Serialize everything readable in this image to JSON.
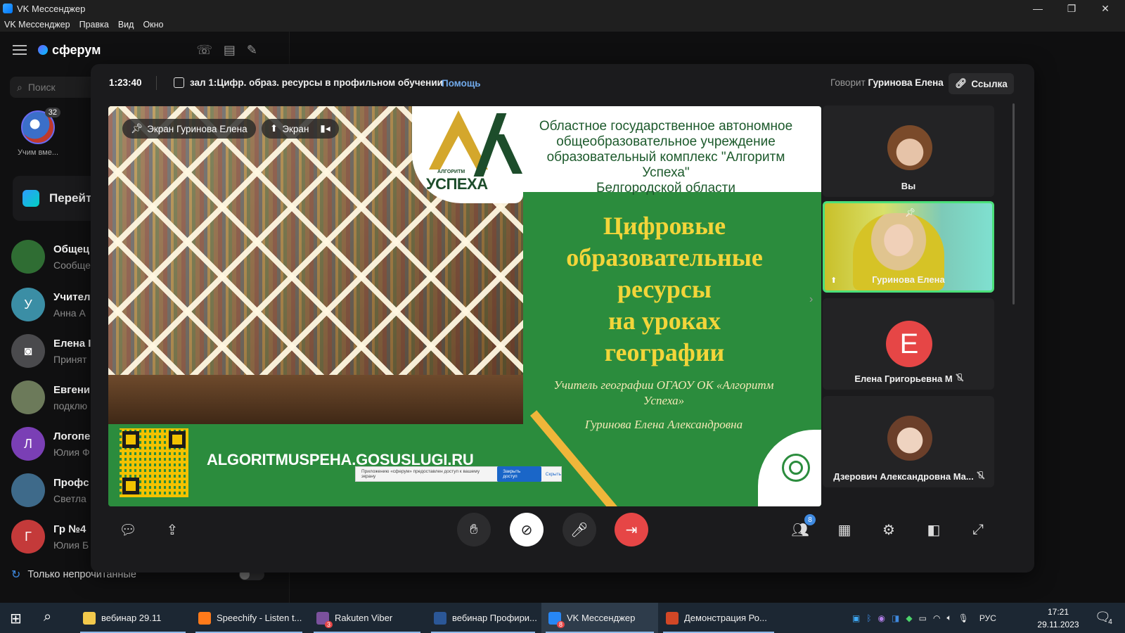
{
  "window": {
    "title": "VK Мессенджер",
    "menu": [
      "VK Мессенджер",
      "Правка",
      "Вид",
      "Окно"
    ]
  },
  "sidebar": {
    "brand": "сферум",
    "search_placeholder": "Поиск",
    "story": {
      "count": "32",
      "label": "Учим вме..."
    },
    "goto_label": "Перейт",
    "chats": [
      {
        "name": "Общец",
        "preview": "Сообще",
        "avatar": "logo",
        "color": "#2f6d33"
      },
      {
        "name": "Учител",
        "preview": "Анна А",
        "avatar": "У",
        "color": "#3b8ea5"
      },
      {
        "name": "Елена I",
        "preview": "Принят",
        "avatar": "camera",
        "color": "#4a4a4d"
      },
      {
        "name": "Евгени",
        "preview": "подклю",
        "avatar": "photo",
        "color": "#6c7a5a"
      },
      {
        "name": "Логопе",
        "preview": "Юлия Ф",
        "avatar": "Л",
        "color": "#7a3fb5"
      },
      {
        "name": "Профс",
        "preview": "Светла",
        "avatar": "photo",
        "color": "#3e6a8a"
      },
      {
        "name": "Гр №4",
        "preview": "Юлия Б",
        "avatar": "Г",
        "color": "#c43a3a"
      }
    ],
    "unread_only_label": "Только непрочитанные"
  },
  "call": {
    "timer": "1:23:40",
    "room_title": "зал 1:Цифр. образ. ресурсы в профильном обучении",
    "help": "Помощь",
    "speaking_prefix": "Говорит",
    "speaking_name": "Гуринова Елена",
    "link_button": "Ссылка",
    "screen_chip": "Экран Гуринова Елена",
    "screen_toggle": "Экран",
    "slide": {
      "org_lines": [
        "Областное государственное автономное",
        "общеобразовательное учреждение",
        "образовательный комплекс \"Алгоритм Успеха\"",
        "Белгородской области"
      ],
      "logo_small": "АЛГОРИТМ",
      "logo_text": "УСПЕХА",
      "title_lines": [
        "Цифровые",
        "образовательные",
        "ресурсы",
        "на уроках",
        "географии"
      ],
      "teacher_line": "Учитель географии ОГАОУ ОК «Алгоритм Успеха»",
      "teacher_name": "Гуринова Елена Александровна",
      "website": "ALGORITMUSPEHA.GOSUSLUGI.RU",
      "share_notice": "Приложению «сферум» предоставлен доступ к вашему экрану",
      "share_stop": "Закрыть доступ",
      "share_hide": "Скрыть"
    },
    "participants": [
      {
        "name": "Вы",
        "type": "face"
      },
      {
        "name": "Гуринова Елена",
        "type": "video",
        "active": true
      },
      {
        "name": "Елена Григорьевна М",
        "type": "letter",
        "letter": "Е",
        "muted": true
      },
      {
        "name": "Дзерович Александровна Ма...",
        "type": "face",
        "muted": true
      }
    ],
    "participants_badge": "8"
  },
  "taskbar": {
    "items": [
      {
        "label": "вебинар 29.11",
        "icon_color": "#f2c94c"
      },
      {
        "label": "Speechify - Listen t...",
        "icon_color": "#ff7a1a"
      },
      {
        "label": "Rakuten Viber",
        "icon_color": "#7b519d",
        "badge": "3"
      },
      {
        "label": "вебинар Профири...",
        "icon_color": "#2b5797"
      },
      {
        "label": "VK Мессенджер",
        "icon_color": "#2787f5",
        "badge": "8",
        "active": true
      },
      {
        "label": "Демонстрация Ро...",
        "icon_color": "#d24726"
      }
    ],
    "lang": "РУС",
    "time": "17:21",
    "date": "29.11.2023",
    "notifications": "4"
  }
}
